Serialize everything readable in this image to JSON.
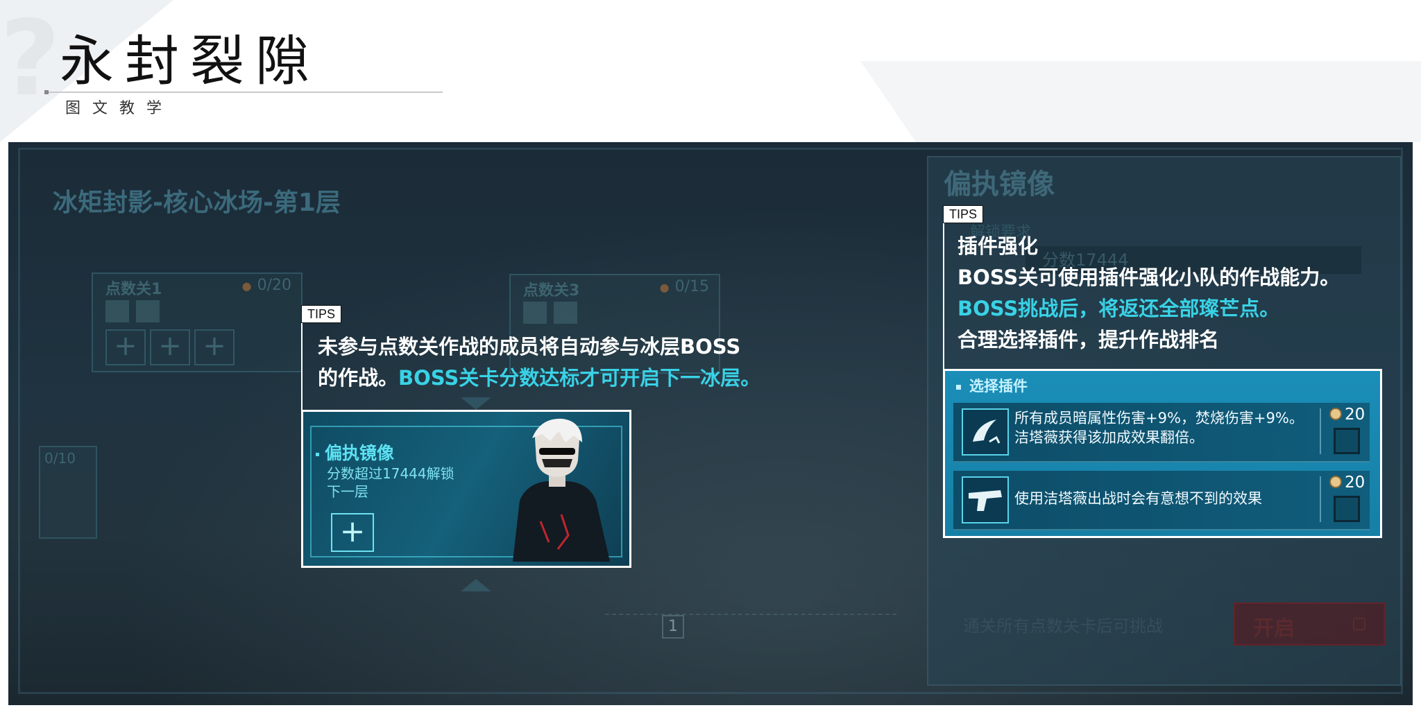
{
  "header": {
    "title": "永封裂隙",
    "subtitle": "图文教学"
  },
  "game": {
    "floor_title": "冰矩封影-核心冰场-第1层",
    "stages": [
      {
        "name": "点数关1",
        "count": "0/20"
      },
      {
        "name": "点数关3",
        "count": "0/15"
      }
    ],
    "left_count": "0/10",
    "bottom_number": "1",
    "right_panel": {
      "title": "偏执镜像",
      "requirement_label": "解锁要求",
      "score_label": "分数17444",
      "condition": "通关所有点数关卡后可挑战",
      "open_button": "开启"
    }
  },
  "tips_left": {
    "tag": "TIPS",
    "line1": "未参与点数关作战的成员将自动参与冰层BOSS",
    "line2_white": "的作战。",
    "line2_cyan": "BOSS关卡分数达标才可开启下一冰层。"
  },
  "preview": {
    "title": "偏执镜像",
    "desc_line1": "分数超过17444解锁",
    "desc_line2": "下一层",
    "plus": "+"
  },
  "tips_right": {
    "tag": "TIPS",
    "heading": "插件强化",
    "line1": "BOSS关可使用插件强化小队的作战能力。",
    "line2_cyan": "BOSS挑战后，将返还全部璨芒点。",
    "line3": "合理选择插件，提升作战排名"
  },
  "plugin_panel": {
    "header": "选择插件",
    "items": [
      {
        "icon": "claw-blade-icon",
        "description": "所有成员暗属性伤害+9%，焚烧伤害+9%。洁塔薇获得该加成效果翻倍。",
        "cost": "20"
      },
      {
        "icon": "pistol-icon",
        "description": "使用洁塔薇出战时会有意想不到的效果",
        "cost": "20"
      }
    ]
  },
  "colors": {
    "accent_cyan": "#39d2e6",
    "plugin_panel_blue": "#1a8eb8",
    "open_button_red": "#5f1419"
  }
}
